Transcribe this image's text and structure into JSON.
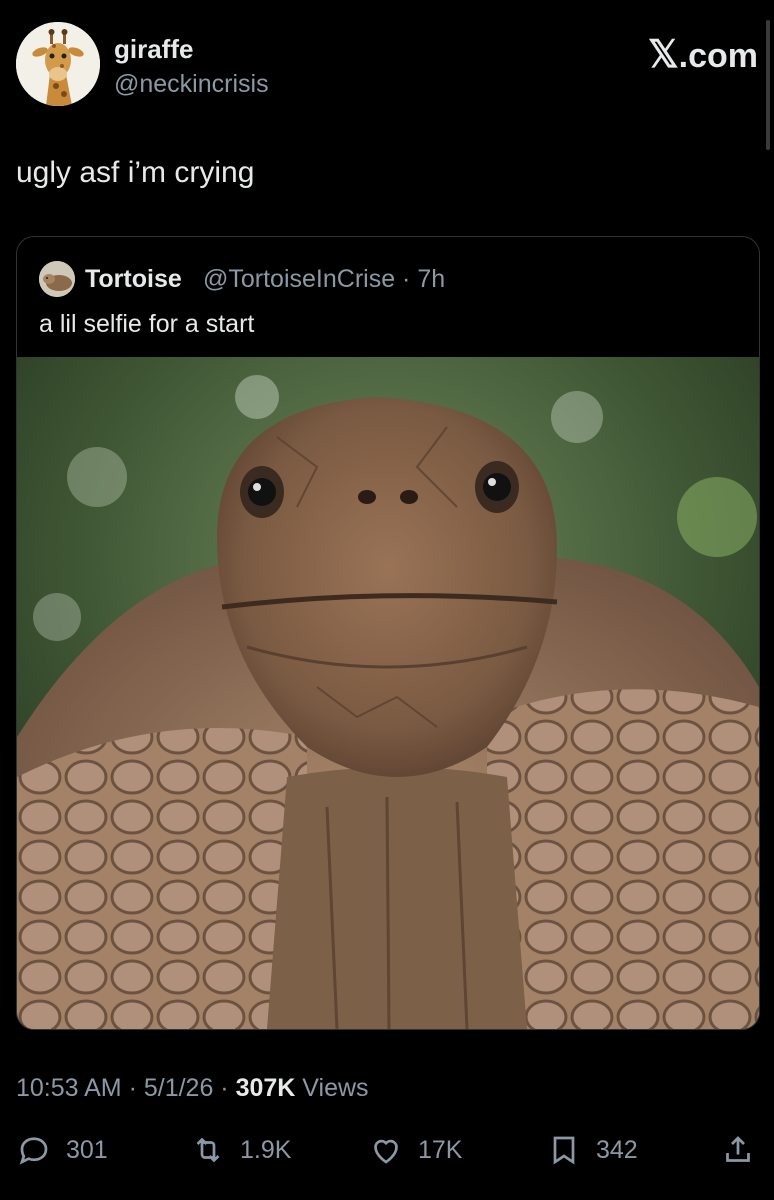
{
  "author": {
    "name": "giraffe",
    "handle": "@neckincrisis",
    "avatar_icon": "giraffe-avatar-icon"
  },
  "brand": {
    "label": ".com",
    "glyph": "𝕏"
  },
  "tweet": {
    "text": "ugly asf i’m crying"
  },
  "quote": {
    "name": "Tortoise",
    "meta": "@TortoiseInCrise · 7h",
    "text": "a lil selfie for a start",
    "avatar_icon": "tortoise-avatar-icon",
    "photo": "tortoise-selfie-photo"
  },
  "timestamp": {
    "time_date": "10:53 AM · 5/1/26 · ",
    "views_count": "307K",
    "views_label": " Views"
  },
  "actions": {
    "replies": "301",
    "reposts": "1.9K",
    "likes": "17K",
    "bookmarks": "342"
  },
  "colors": {
    "background": "#000000",
    "text": "#e7e9ea",
    "muted": "#8b98a5",
    "border": "#2f3336"
  }
}
